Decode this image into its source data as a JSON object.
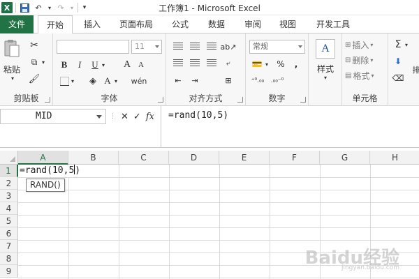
{
  "window": {
    "title": "工作簿1 - Microsoft Excel",
    "qat_icons": [
      "excel-logo-icon",
      "save-icon",
      "undo-icon",
      "redo-icon",
      "customize-icon"
    ]
  },
  "tabs": [
    "文件",
    "开始",
    "插入",
    "页面布局",
    "公式",
    "数据",
    "审阅",
    "视图",
    "开发工具"
  ],
  "active_tab": "开始",
  "ribbon": {
    "clipboard": {
      "label": "剪贴板",
      "paste": "粘贴"
    },
    "font": {
      "label": "字体",
      "font_name": "",
      "font_size": "11",
      "bold": "B",
      "italic": "I",
      "underline": "U",
      "grow": "A",
      "shrink": "A"
    },
    "alignment": {
      "label": "对齐方式"
    },
    "number": {
      "label": "数字",
      "format": "常规",
      "percent": "%"
    },
    "styles": {
      "button": "样式"
    },
    "cells": {
      "label": "单元格",
      "insert": "插入",
      "delete": "删除",
      "format": "格式"
    },
    "editing": {
      "sum": "Σ"
    }
  },
  "formula_bar": {
    "name_box": "MID",
    "cancel": "✕",
    "enter": "✓",
    "fx": "fx",
    "formula": "=rand(10,5)"
  },
  "grid": {
    "columns": [
      "A",
      "B",
      "C",
      "D",
      "E",
      "F",
      "G",
      "H"
    ],
    "rows": [
      "1",
      "2",
      "3",
      "4",
      "5",
      "6",
      "7",
      "8",
      "9"
    ],
    "selected_column": "A",
    "selected_row": "1",
    "edit_cell_text": "=rand(10,5",
    "edit_cell_tail": ")",
    "autocomplete_tip": "RAND()"
  },
  "watermark": {
    "text": "Baidu经验",
    "sub": "jingyan.baidu.com"
  },
  "colors": {
    "excel_green": "#217346",
    "ribbon_bg": "#f7f7f7",
    "header_bg": "#f2f2f2"
  }
}
